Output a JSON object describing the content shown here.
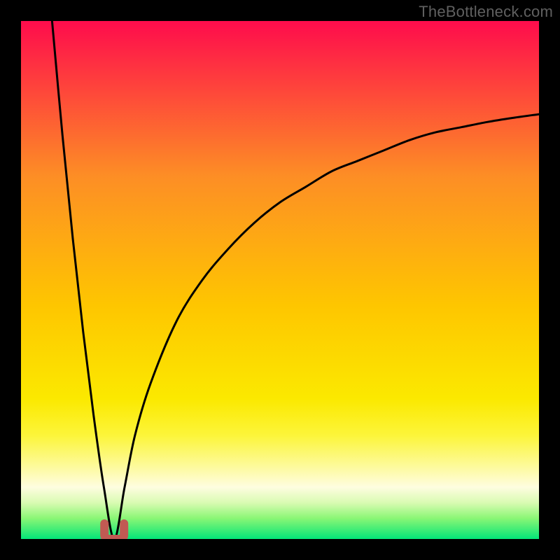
{
  "watermark": "TheBottleneck.com",
  "colors": {
    "top": "#fe0c4c",
    "mid_upper": "#fd8e25",
    "mid": "#fec600",
    "mid_lower": "#fbe900",
    "pale_yellow": "#fdfa9c",
    "near_bottom": "#8af675",
    "bottom": "#03e578",
    "curve": "#000000",
    "marker": "#c15a53",
    "frame": "#000000"
  },
  "chart_data": {
    "type": "line",
    "title": "",
    "xlabel": "",
    "ylabel": "",
    "xlim": [
      0,
      100
    ],
    "ylim": [
      0,
      100
    ],
    "annotations": [],
    "series": [
      {
        "name": "bottleneck-curve",
        "description": "V-shaped bottleneck curve; minimum near x≈18, y≈0; left arm rises steeply to ~100 at x≈6; right arm rises asymptotically toward ~82 at x=100",
        "x": [
          6,
          8,
          10,
          12,
          14,
          16,
          18,
          20,
          22,
          25,
          30,
          35,
          40,
          45,
          50,
          55,
          60,
          65,
          70,
          75,
          80,
          85,
          90,
          95,
          100
        ],
        "y": [
          100,
          78,
          58,
          40,
          24,
          10,
          0,
          10,
          20,
          30,
          42,
          50,
          56,
          61,
          65,
          68,
          71,
          73,
          75,
          77,
          78.5,
          79.5,
          80.5,
          81.3,
          82
        ]
      }
    ],
    "marker": {
      "name": "U-shaped-minimum-marker",
      "x": 18,
      "y": 0,
      "color": "#c15a53"
    },
    "gradient_stops_vertical_pct": [
      {
        "pct": 0,
        "color": "#fe0c4c"
      },
      {
        "pct": 30,
        "color": "#fd8e25"
      },
      {
        "pct": 55,
        "color": "#fec600"
      },
      {
        "pct": 73,
        "color": "#fbe900"
      },
      {
        "pct": 86,
        "color": "#fdfa9c"
      },
      {
        "pct": 96,
        "color": "#8af675"
      },
      {
        "pct": 100,
        "color": "#03e578"
      }
    ]
  }
}
